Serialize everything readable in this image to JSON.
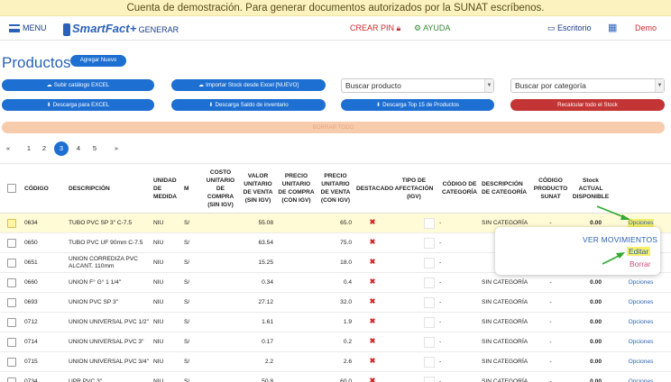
{
  "banner": {
    "text": "Cuenta de demostración. Para generar documentos autorizados por la SUNAT escríbenos."
  },
  "nav": {
    "menu": "MENU",
    "logo": "SmartFact",
    "generar": "GENERAR",
    "crear_pin": "CREAR PIN",
    "ayuda": "AYUDA",
    "escritorio": "Escritorio",
    "demo": "Demo"
  },
  "page": {
    "title": "Productos",
    "add_new": "Agregar Nuevo"
  },
  "toolbar": {
    "subir_excel": "Subir catálogo EXCEL",
    "importar_stock": "Importar Stock desde Excel [NUEVO]",
    "buscar_producto": "Buscar producto",
    "buscar_categoria": "Buscar por categoría",
    "descarga_excel": "Descarga para EXCEL",
    "descarga_saldo": "Descarga Saldo de inventario",
    "descarga_top": "Descarga Top 15 de Productos",
    "recalcular": "Recalcular todo el Stock",
    "borrar_todo": "BORRAR TODO"
  },
  "pagination": {
    "prev": "«",
    "pages": [
      "1",
      "2",
      "3",
      "4",
      "5"
    ],
    "active": "3",
    "next": "»"
  },
  "table": {
    "headers": {
      "codigo": "CÓDIGO",
      "descripcion": "DESCRIPCIÓN",
      "unidad": "UNIDAD DE MEDIDA",
      "m": "M",
      "costo": "COSTO UNITARIO DE COMPRA (SIN IGV)",
      "valor": "VALOR UNITARIO DE VENTA (SIN IGV)",
      "precio_compra": "PRECIO UNITARIO DE COMPRA (CON IGV)",
      "precio_venta": "PRECIO UNITARIO DE VENTA (CON IGV)",
      "destacado": "DESTACADO",
      "tipo_afectacion": "TIPO DE AFECTACIÓN (IGV)",
      "codigo_categoria": "CÓDIGO DE CATEGORÍA",
      "desc_categoria": "DESCRIPCIÓN DE CATEGORÍA",
      "codigo_sunat": "CÓDIGO PRODUCTO SUNAT",
      "stock": "Stock ACTUAL DISPONIBLE"
    },
    "rows": [
      {
        "codigo": "0634",
        "descripcion": "TUBO PVC SP 3\" C-7.5",
        "unidad": "NIU",
        "m": "S/",
        "valor": "55.08",
        "precio": "65.0",
        "cat": "-",
        "desc_cat": "SIN CATEGORÍA",
        "sunat": "-",
        "stock": "0.00",
        "opciones": "Opciones"
      },
      {
        "codigo": "0650",
        "descripcion": "TUBO PVC UF 90mm C-7.5",
        "unidad": "NIU",
        "m": "S/",
        "valor": "63.54",
        "precio": "75.0",
        "cat": "-",
        "desc_cat": "",
        "sunat": "",
        "stock": "",
        "opciones": ""
      },
      {
        "codigo": "0651",
        "descripcion": "UNION CORREDIZA PVC ALCANT. 110mm",
        "unidad": "NIU",
        "m": "S/",
        "valor": "15.25",
        "precio": "18.0",
        "cat": "-",
        "desc_cat": "",
        "sunat": "",
        "stock": "",
        "opciones": ""
      },
      {
        "codigo": "0660",
        "descripcion": "UNION F° G° 1 1/4\"",
        "unidad": "NIU",
        "m": "S/",
        "valor": "0.34",
        "precio": "0.4",
        "cat": "-",
        "desc_cat": "SIN CATEGORÍA",
        "sunat": "-",
        "stock": "0.00",
        "opciones": "Opciones"
      },
      {
        "codigo": "0693",
        "descripcion": "UNION PVC SP 3\"",
        "unidad": "NIU",
        "m": "S/",
        "valor": "27.12",
        "precio": "32.0",
        "cat": "-",
        "desc_cat": "SIN CATEGORÍA",
        "sunat": "-",
        "stock": "0.00",
        "opciones": "Opciones"
      },
      {
        "codigo": "0712",
        "descripcion": "UNION UNIVERSAL PVC 1/2\"",
        "unidad": "NIU",
        "m": "S/",
        "valor": "1.61",
        "precio": "1.9",
        "cat": "-",
        "desc_cat": "SIN CATEGORÍA",
        "sunat": "-",
        "stock": "0.00",
        "opciones": "Opciones"
      },
      {
        "codigo": "0714",
        "descripcion": "UNION UNIVERSAL PVC 3\"",
        "unidad": "NIU",
        "m": "S/",
        "valor": "0.17",
        "precio": "0.2",
        "cat": "-",
        "desc_cat": "SIN CATEGORÍA",
        "sunat": "-",
        "stock": "0.00",
        "opciones": "Opciones"
      },
      {
        "codigo": "0715",
        "descripcion": "UNION UNIVERSAL PVC 3/4\"",
        "unidad": "NIU",
        "m": "S/",
        "valor": "2.2",
        "precio": "2.6",
        "cat": "-",
        "desc_cat": "SIN CATEGORÍA",
        "sunat": "-",
        "stock": "0.00",
        "opciones": "Opciones"
      },
      {
        "codigo": "0734",
        "descripcion": "UPR PVC 3\"",
        "unidad": "NIU",
        "m": "S/",
        "valor": "50.8",
        "precio": "60.0",
        "cat": "-",
        "desc_cat": "SIN CATEGORÍA",
        "sunat": "-",
        "stock": "0.00",
        "opciones": "Opciones"
      }
    ]
  },
  "popup": {
    "ver_movimientos": "VER MOVIMIENTOS",
    "editar": "Editar",
    "borrar": "Borrar"
  },
  "colors": {
    "primary": "#1e6fd2",
    "danger": "#c33535",
    "highlight": "#f6f06a",
    "arrow": "#2faa2f"
  }
}
